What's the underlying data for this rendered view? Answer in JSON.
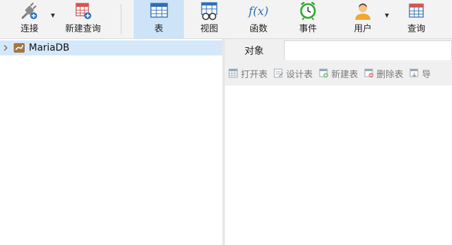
{
  "toolbar": {
    "connect_label": "连接",
    "new_query_label": "新建查询",
    "table_label": "表",
    "view_label": "视图",
    "function_label": "函数",
    "event_label": "事件",
    "user_label": "用户",
    "query_label": "查询",
    "function_icon_text": "f(x)"
  },
  "tree": {
    "connection_label": "MariaDB"
  },
  "objects": {
    "tab_label": "对象",
    "open_table": "打开表",
    "design_table": "设计表",
    "new_table": "新建表",
    "delete_table": "删除表",
    "import_partial": "导"
  },
  "colors": {
    "active_tab_bg": "#cde3f7",
    "tree_selected_bg": "#d5e8fa",
    "grid_blue": "#2f6fb5",
    "event_green": "#2aa52a",
    "user_orange": "#f0a830"
  }
}
